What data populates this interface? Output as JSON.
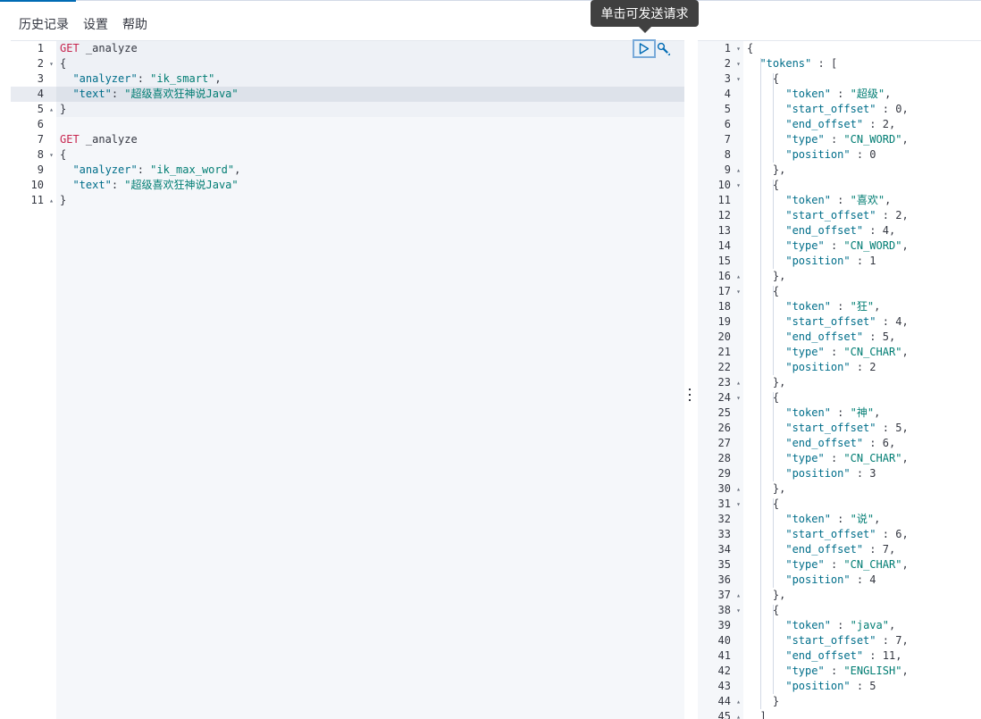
{
  "menu": {
    "history": "历史记录",
    "settings": "设置",
    "help": "帮助"
  },
  "tooltip": {
    "run": "单击可发送请求"
  },
  "icons": {
    "run": "play-icon",
    "wrench": "wrench-icon",
    "splitter": "vertical-dots-icon"
  },
  "request": {
    "gutter": [
      {
        "n": "1",
        "fold": ""
      },
      {
        "n": "2",
        "fold": "▾"
      },
      {
        "n": "3",
        "fold": ""
      },
      {
        "n": "4",
        "fold": ""
      },
      {
        "n": "5",
        "fold": "▴"
      },
      {
        "n": "6",
        "fold": ""
      },
      {
        "n": "7",
        "fold": ""
      },
      {
        "n": "8",
        "fold": "▾"
      },
      {
        "n": "9",
        "fold": ""
      },
      {
        "n": "10",
        "fold": ""
      },
      {
        "n": "11",
        "fold": "▴"
      }
    ],
    "lines": [
      {
        "method": "GET",
        "url": " _analyze"
      },
      {
        "text": "{"
      },
      {
        "key": "\"analyzer\"",
        "sep": ": ",
        "val": "\"ik_smart\"",
        "end": ","
      },
      {
        "key": "\"text\"",
        "sep": ": ",
        "val": "\"超级喜欢狂神说Java\"",
        "end": ""
      },
      {
        "text": "}"
      },
      {
        "text": ""
      },
      {
        "method": "GET",
        "url": " _analyze"
      },
      {
        "text": "{"
      },
      {
        "key": "\"analyzer\"",
        "sep": ": ",
        "val": "\"ik_max_word\"",
        "end": ","
      },
      {
        "key": "\"text\"",
        "sep": ": ",
        "val": "\"超级喜欢狂神说Java\"",
        "end": ""
      },
      {
        "text": "}"
      }
    ]
  },
  "response": {
    "gutter": [
      {
        "n": "1",
        "fold": "▾"
      },
      {
        "n": "2",
        "fold": "▾"
      },
      {
        "n": "3",
        "fold": "▾"
      },
      {
        "n": "4",
        "fold": ""
      },
      {
        "n": "5",
        "fold": ""
      },
      {
        "n": "6",
        "fold": ""
      },
      {
        "n": "7",
        "fold": ""
      },
      {
        "n": "8",
        "fold": ""
      },
      {
        "n": "9",
        "fold": "▴"
      },
      {
        "n": "10",
        "fold": "▾"
      },
      {
        "n": "11",
        "fold": ""
      },
      {
        "n": "12",
        "fold": ""
      },
      {
        "n": "13",
        "fold": ""
      },
      {
        "n": "14",
        "fold": ""
      },
      {
        "n": "15",
        "fold": ""
      },
      {
        "n": "16",
        "fold": "▴"
      },
      {
        "n": "17",
        "fold": "▾"
      },
      {
        "n": "18",
        "fold": ""
      },
      {
        "n": "19",
        "fold": ""
      },
      {
        "n": "20",
        "fold": ""
      },
      {
        "n": "21",
        "fold": ""
      },
      {
        "n": "22",
        "fold": ""
      },
      {
        "n": "23",
        "fold": "▴"
      },
      {
        "n": "24",
        "fold": "▾"
      },
      {
        "n": "25",
        "fold": ""
      },
      {
        "n": "26",
        "fold": ""
      },
      {
        "n": "27",
        "fold": ""
      },
      {
        "n": "28",
        "fold": ""
      },
      {
        "n": "29",
        "fold": ""
      },
      {
        "n": "30",
        "fold": "▴"
      },
      {
        "n": "31",
        "fold": "▾"
      },
      {
        "n": "32",
        "fold": ""
      },
      {
        "n": "33",
        "fold": ""
      },
      {
        "n": "34",
        "fold": ""
      },
      {
        "n": "35",
        "fold": ""
      },
      {
        "n": "36",
        "fold": ""
      },
      {
        "n": "37",
        "fold": "▴"
      },
      {
        "n": "38",
        "fold": "▾"
      },
      {
        "n": "39",
        "fold": ""
      },
      {
        "n": "40",
        "fold": ""
      },
      {
        "n": "41",
        "fold": ""
      },
      {
        "n": "42",
        "fold": ""
      },
      {
        "n": "43",
        "fold": ""
      },
      {
        "n": "44",
        "fold": "▴"
      },
      {
        "n": "45",
        "fold": "▴"
      }
    ],
    "lines": [
      {
        "p": "{"
      },
      {
        "ind": "  ",
        "k": "\"tokens\"",
        "s": " : ",
        "p": "["
      },
      {
        "ind": "    ",
        "p": "{"
      },
      {
        "ind": "      ",
        "k": "\"token\"",
        "s": " : ",
        "v": "\"超级\"",
        "e": ","
      },
      {
        "ind": "      ",
        "k": "\"start_offset\"",
        "s": " : ",
        "n": "0",
        "e": ","
      },
      {
        "ind": "      ",
        "k": "\"end_offset\"",
        "s": " : ",
        "n": "2",
        "e": ","
      },
      {
        "ind": "      ",
        "k": "\"type\"",
        "s": " : ",
        "v": "\"CN_WORD\"",
        "e": ","
      },
      {
        "ind": "      ",
        "k": "\"position\"",
        "s": " : ",
        "n": "0"
      },
      {
        "ind": "    ",
        "p": "},"
      },
      {
        "ind": "    ",
        "p": "{"
      },
      {
        "ind": "      ",
        "k": "\"token\"",
        "s": " : ",
        "v": "\"喜欢\"",
        "e": ","
      },
      {
        "ind": "      ",
        "k": "\"start_offset\"",
        "s": " : ",
        "n": "2",
        "e": ","
      },
      {
        "ind": "      ",
        "k": "\"end_offset\"",
        "s": " : ",
        "n": "4",
        "e": ","
      },
      {
        "ind": "      ",
        "k": "\"type\"",
        "s": " : ",
        "v": "\"CN_WORD\"",
        "e": ","
      },
      {
        "ind": "      ",
        "k": "\"position\"",
        "s": " : ",
        "n": "1"
      },
      {
        "ind": "    ",
        "p": "},"
      },
      {
        "ind": "    ",
        "p": "{"
      },
      {
        "ind": "      ",
        "k": "\"token\"",
        "s": " : ",
        "v": "\"狂\"",
        "e": ","
      },
      {
        "ind": "      ",
        "k": "\"start_offset\"",
        "s": " : ",
        "n": "4",
        "e": ","
      },
      {
        "ind": "      ",
        "k": "\"end_offset\"",
        "s": " : ",
        "n": "5",
        "e": ","
      },
      {
        "ind": "      ",
        "k": "\"type\"",
        "s": " : ",
        "v": "\"CN_CHAR\"",
        "e": ","
      },
      {
        "ind": "      ",
        "k": "\"position\"",
        "s": " : ",
        "n": "2"
      },
      {
        "ind": "    ",
        "p": "},"
      },
      {
        "ind": "    ",
        "p": "{"
      },
      {
        "ind": "      ",
        "k": "\"token\"",
        "s": " : ",
        "v": "\"神\"",
        "e": ","
      },
      {
        "ind": "      ",
        "k": "\"start_offset\"",
        "s": " : ",
        "n": "5",
        "e": ","
      },
      {
        "ind": "      ",
        "k": "\"end_offset\"",
        "s": " : ",
        "n": "6",
        "e": ","
      },
      {
        "ind": "      ",
        "k": "\"type\"",
        "s": " : ",
        "v": "\"CN_CHAR\"",
        "e": ","
      },
      {
        "ind": "      ",
        "k": "\"position\"",
        "s": " : ",
        "n": "3"
      },
      {
        "ind": "    ",
        "p": "},"
      },
      {
        "ind": "    ",
        "p": "{"
      },
      {
        "ind": "      ",
        "k": "\"token\"",
        "s": " : ",
        "v": "\"说\"",
        "e": ","
      },
      {
        "ind": "      ",
        "k": "\"start_offset\"",
        "s": " : ",
        "n": "6",
        "e": ","
      },
      {
        "ind": "      ",
        "k": "\"end_offset\"",
        "s": " : ",
        "n": "7",
        "e": ","
      },
      {
        "ind": "      ",
        "k": "\"type\"",
        "s": " : ",
        "v": "\"CN_CHAR\"",
        "e": ","
      },
      {
        "ind": "      ",
        "k": "\"position\"",
        "s": " : ",
        "n": "4"
      },
      {
        "ind": "    ",
        "p": "},"
      },
      {
        "ind": "    ",
        "p": "{"
      },
      {
        "ind": "      ",
        "k": "\"token\"",
        "s": " : ",
        "v": "\"java\"",
        "e": ","
      },
      {
        "ind": "      ",
        "k": "\"start_offset\"",
        "s": " : ",
        "n": "7",
        "e": ","
      },
      {
        "ind": "      ",
        "k": "\"end_offset\"",
        "s": " : ",
        "n": "11",
        "e": ","
      },
      {
        "ind": "      ",
        "k": "\"type\"",
        "s": " : ",
        "v": "\"ENGLISH\"",
        "e": ","
      },
      {
        "ind": "      ",
        "k": "\"position\"",
        "s": " : ",
        "n": "5"
      },
      {
        "ind": "    ",
        "p": "}"
      },
      {
        "ind": "  ",
        "p": "]"
      }
    ]
  }
}
